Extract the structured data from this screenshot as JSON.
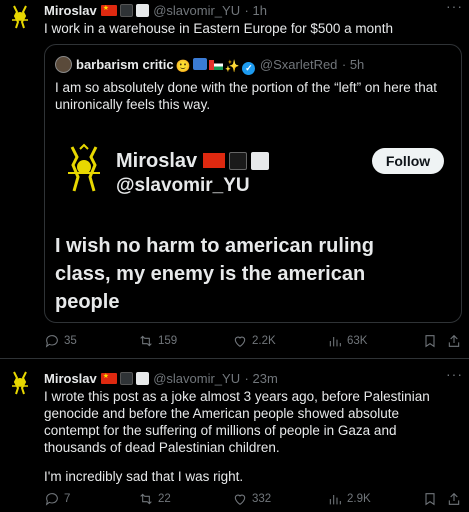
{
  "tweet1": {
    "name": "Miroslav",
    "handle": "@slavomir_YU",
    "time": "· 1h",
    "text": "I work in a warehouse in Eastern Europe for $500 a month"
  },
  "quote": {
    "name": "barbarism critic",
    "handle": "@SxarletRed",
    "time": "· 5h",
    "text": "I am so absolutely done with the portion of the “left” on here that unironically feels this way.",
    "embed": {
      "name": "Miroslav",
      "handle": "@slavomir_YU",
      "follow_label": "Follow",
      "text": "I wish no harm to american ruling class, my enemy is the american people"
    }
  },
  "actions1": {
    "replies": "35",
    "reposts": "159",
    "likes": "2.2K",
    "views": "63K"
  },
  "tweet2": {
    "name": "Miroslav",
    "handle": "@slavomir_YU",
    "time": "· 23m",
    "text_p1": "I wrote this post as a joke almost 3 years ago, before Palestinian genocide and before the American people showed absolute contempt for the suffering of millions of people in Gaza and thousands of dead Palestinian children.",
    "text_p2": "I'm incredibly sad that I was right."
  },
  "actions2": {
    "replies": "7",
    "reposts": "22",
    "likes": "332",
    "views": "2.9K"
  },
  "colors": {
    "background": "#000000",
    "text": "#e7e9ea",
    "muted": "#71767b",
    "border": "#2f3336",
    "verified": "#1d9bf0",
    "avatar_yellow": "#e8d800"
  },
  "icons": {
    "more": "more-horizontal-icon",
    "reply": "reply-icon",
    "repost": "repost-icon",
    "like": "heart-icon",
    "views": "views-icon",
    "bookmark": "bookmark-icon",
    "share": "share-icon",
    "verified": "verified-badge-icon"
  }
}
